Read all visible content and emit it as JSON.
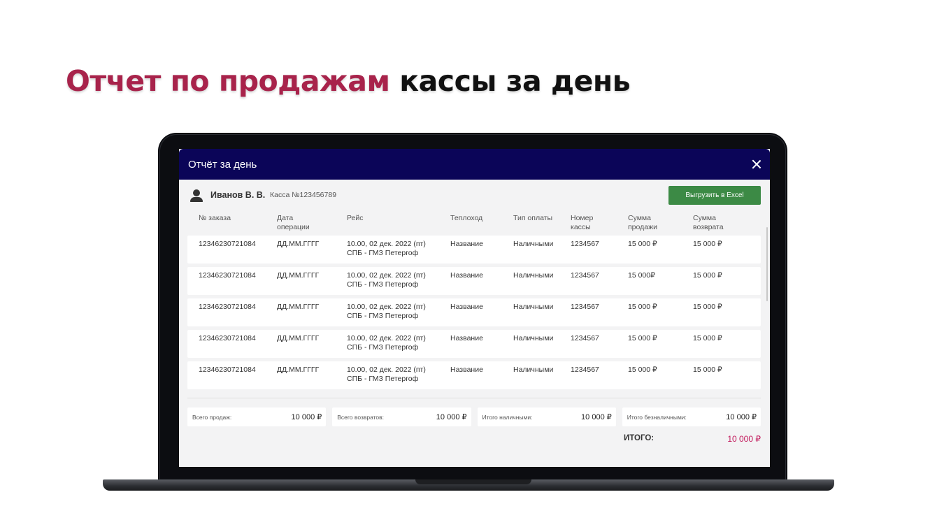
{
  "headline": {
    "accent": "Отчет по продажам",
    "rest": "кассы за день"
  },
  "modal": {
    "title": "Отчёт за день",
    "close_icon": "close-icon"
  },
  "user": {
    "icon": "user-icon",
    "name": "Иванов В. В.",
    "cashbox": "Касса №123456789"
  },
  "export_button": {
    "label": "Выгрузить в Excel",
    "color": "#3c8a45"
  },
  "table": {
    "headers": [
      {
        "line1": "№ заказа",
        "line2": ""
      },
      {
        "line1": "Дата",
        "line2": "операции"
      },
      {
        "line1": "Рейс",
        "line2": ""
      },
      {
        "line1": "Теплоход",
        "line2": ""
      },
      {
        "line1": "Тип оплаты",
        "line2": ""
      },
      {
        "line1": "Номер",
        "line2": "кассы"
      },
      {
        "line1": "Сумма",
        "line2": "продажи"
      },
      {
        "line1": "Сумма",
        "line2": "возврата"
      }
    ],
    "rows": [
      {
        "order": "12346230721084",
        "date": "ДД.ММ.ГГГГ",
        "trip_time": "10.00, 02 дек. 2022 (пт)",
        "trip_route": "СПБ - ГМЗ Петергоф",
        "ship": "Название",
        "payment": "Наличными",
        "register": "1234567",
        "sale": "15 000 ₽",
        "refund": "15 000 ₽"
      },
      {
        "order": "12346230721084",
        "date": "ДД.ММ.ГГГГ",
        "trip_time": "10.00, 02 дек. 2022 (пт)",
        "trip_route": "СПБ - ГМЗ Петергоф",
        "ship": "Название",
        "payment": "Наличными",
        "register": "1234567",
        "sale": "15 000₽",
        "refund": "15 000 ₽"
      },
      {
        "order": "12346230721084",
        "date": "ДД.ММ.ГГГГ",
        "trip_time": "10.00, 02 дек. 2022 (пт)",
        "trip_route": "СПБ - ГМЗ Петергоф",
        "ship": "Название",
        "payment": "Наличными",
        "register": "1234567",
        "sale": "15 000 ₽",
        "refund": "15 000 ₽"
      },
      {
        "order": "12346230721084",
        "date": "ДД.ММ.ГГГГ",
        "trip_time": "10.00, 02 дек. 2022 (пт)",
        "trip_route": "СПБ - ГМЗ Петергоф",
        "ship": "Название",
        "payment": "Наличными",
        "register": "1234567",
        "sale": "15 000 ₽",
        "refund": "15 000 ₽"
      },
      {
        "order": "12346230721084",
        "date": "ДД.ММ.ГГГГ",
        "trip_time": "10.00, 02 дек. 2022 (пт)",
        "trip_route": "СПБ - ГМЗ Петергоф",
        "ship": "Название",
        "payment": "Наличными",
        "register": "1234567",
        "sale": "15 000 ₽",
        "refund": "15 000 ₽"
      }
    ]
  },
  "totals": [
    {
      "label": "Всего продаж:",
      "value": "10 000 ₽"
    },
    {
      "label": "Всего возвратов:",
      "value": "10 000 ₽"
    },
    {
      "label": "Итого наличными:",
      "value": "10 000 ₽"
    },
    {
      "label": "Итого безналичными:",
      "value": "10 000 ₽"
    }
  ],
  "grand_total": {
    "label": "ИТОГО:",
    "value": "10 000 ₽",
    "color": "#c2185b"
  },
  "colors": {
    "header_bg": "#0b0558",
    "headline_accent": "#a8234b"
  }
}
